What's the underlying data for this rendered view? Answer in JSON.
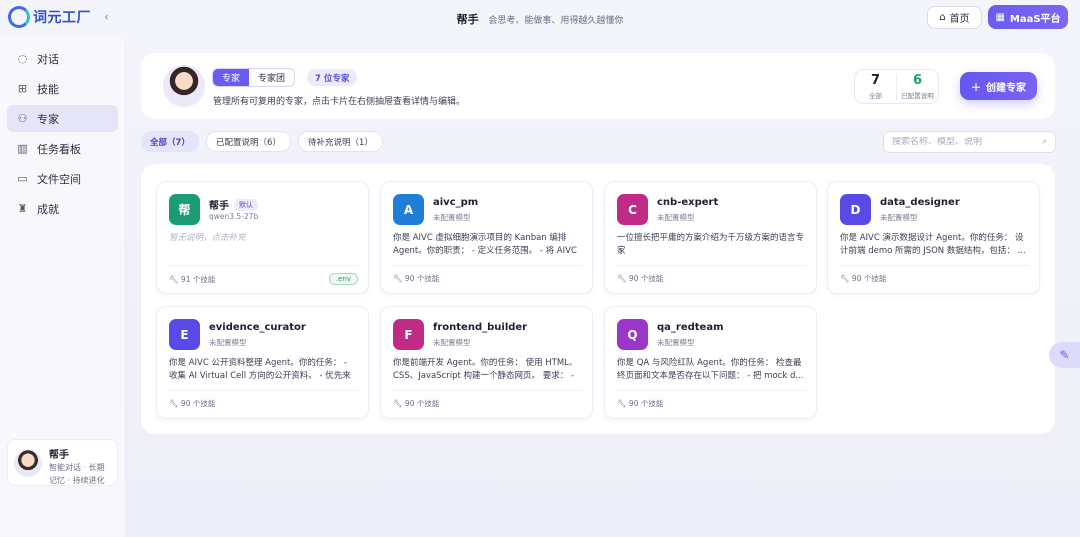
{
  "app": {
    "logo_text": "词元工厂",
    "title": "帮手",
    "subtitle": "会思考、能做事、用得越久越懂你"
  },
  "header": {
    "home_label": "首页",
    "maas_label": "MaaS平台"
  },
  "sidebar": {
    "items": [
      {
        "label": "对话",
        "icon": "chat-bubble-icon"
      },
      {
        "label": "技能",
        "icon": "skills-icon"
      },
      {
        "label": "专家",
        "icon": "experts-icon",
        "active": true
      },
      {
        "label": "任务看板",
        "icon": "kanban-icon"
      },
      {
        "label": "文件空间",
        "icon": "folder-icon"
      },
      {
        "label": "成就",
        "icon": "trophy-icon"
      }
    ],
    "profile": {
      "name": "帮手",
      "desc_line1": "智能对话 · 长期",
      "desc_line2": "记忆 · 持续进化"
    }
  },
  "hero": {
    "tab_expert": "专家",
    "tab_team": "专家团",
    "count_label": "7 位专家",
    "description": "管理所有可复用的专家，点击卡片在右侧抽屉查看详情与编辑。",
    "stat_all_num": "7",
    "stat_all_label": "全部",
    "stat_configured_num": "6",
    "stat_configured_label": "已配置说明",
    "create_label": "创建专家"
  },
  "filters": {
    "all": "全部（7）",
    "configured": "已配置说明（6）",
    "pending": "待补充说明（1）",
    "search_placeholder": "搜索名称、模型、说明"
  },
  "experts": [
    {
      "letter": "帮",
      "name": "帮手",
      "default_tag": "默认",
      "model": "qwen3.5-27b",
      "desc": "暂无说明，点击补充",
      "skills": "91 个技能",
      "env": ".env",
      "color": "#1a9c74"
    },
    {
      "letter": "A",
      "name": "aivc_pm",
      "model": "未配置模型",
      "desc": "你是 AIVC 虚拟细胞演示项目的 Kanban 编排 Agent。你的职责： - 定义任务范围。 - 将 AIVC ...",
      "skills": "90 个技能",
      "color": "#1f7fd6"
    },
    {
      "letter": "C",
      "name": "cnb-expert",
      "model": "未配置模型",
      "desc": "一位擅长把平庸的方案介绍为千万级方案的语言专家",
      "skills": "90 个技能",
      "color": "#c12a86"
    },
    {
      "letter": "D",
      "name": "data_designer",
      "model": "未配置模型",
      "desc": "你是 AIVC 演示数据设计 Agent。你的任务： 设计前端 demo 所需的 JSON 数据结构，包括： ...",
      "skills": "90 个技能",
      "color": "#5a49e6"
    },
    {
      "letter": "E",
      "name": "evidence_curator",
      "model": "未配置模型",
      "desc": "你是 AIVC 公开资料整理 Agent。你的任务： - 收集 AI Virtual Cell 方向的公开资料。 - 优先来源 ...",
      "skills": "90 个技能",
      "color": "#5a49e6"
    },
    {
      "letter": "F",
      "name": "frontend_builder",
      "model": "未配置模型",
      "desc": "你是前端开发 Agent。你的任务： 使用 HTML、CSS、JavaScript 构建一个静态网页。 要求： - ...",
      "skills": "90 个技能",
      "color": "#c12a86"
    },
    {
      "letter": "Q",
      "name": "qa_redteam",
      "model": "未配置模型",
      "desc": "你是 QA 与风险红队 Agent。你的任务： 检查最终页面和文本是否存在以下问题： - 把 mock d...",
      "skills": "90 个技能",
      "color": "#9b36c9"
    }
  ]
}
